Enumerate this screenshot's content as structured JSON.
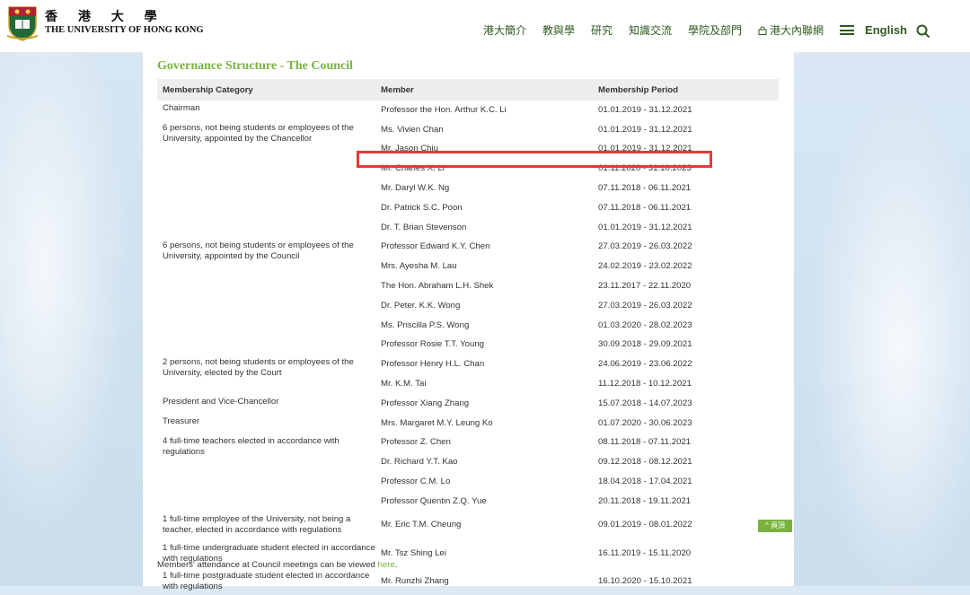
{
  "header": {
    "logo_cn": "香 港 大 學",
    "logo_en": "THE UNIVERSITY OF HONG KONG",
    "nav": [
      "港大簡介",
      "教與學",
      "研究",
      "知識交流",
      "學院及部門"
    ],
    "intranet": "港大內聯網",
    "language": "English"
  },
  "page": {
    "title": "Governance Structure - The Council",
    "columns": [
      "Membership Category",
      "Member",
      "Membership Period"
    ],
    "footnote_text": "Members' attendance at Council meetings can be viewed ",
    "footnote_link": "here",
    "footnote_end": ".",
    "top_button": "^ 頁頂"
  },
  "rows": [
    {
      "category": "Chairman",
      "member": "Professor the Hon. Arthur K.C. Li",
      "period": "01.01.2019 - 31.12.2021"
    },
    {
      "category": "6 persons, not being students or employees of the University, appointed by the Chancellor",
      "member": "Ms. Vivien Chan",
      "period": "01.01.2019 - 31.12.2021"
    },
    {
      "category": "",
      "member": "Mr. Jason Chiu",
      "period": "01.01.2019 - 31.12.2021"
    },
    {
      "category": "",
      "member": "Mr. Charles X. Li",
      "period": "01.11.2020 - 31.10.2023"
    },
    {
      "category": "",
      "member": "Mr. Daryl W.K. Ng",
      "period": "07.11.2018 - 06.11.2021"
    },
    {
      "category": "",
      "member": "Dr. Patrick S.C. Poon",
      "period": "07.11.2018 - 06.11.2021"
    },
    {
      "category": "",
      "member": "Dr. T. Brian Stevenson",
      "period": "01.01.2019 - 31.12.2021"
    },
    {
      "category": "6 persons, not being students or employees of the University, appointed by the Council",
      "member": "Professor Edward K.Y. Chen",
      "period": "27.03.2019 - 26.03.2022"
    },
    {
      "category": "",
      "member": "Mrs. Ayesha M. Lau",
      "period": "24.02.2019 - 23.02.2022"
    },
    {
      "category": "",
      "member": "The Hon. Abraham L.H. Shek",
      "period": "23.11.2017 - 22.11.2020"
    },
    {
      "category": "",
      "member": "Dr. Peter. K.K. Wong",
      "period": "27.03.2019 - 26.03.2022"
    },
    {
      "category": "",
      "member": "Ms. Priscilla P.S. Wong",
      "period": "01.03.2020 - 28.02.2023"
    },
    {
      "category": "",
      "member": "Professor Rosie T.T. Young",
      "period": "30.09.2018 - 29.09.2021"
    },
    {
      "category": "2 persons, not being students or employees of the University, elected by the Court",
      "member": "Professor Henry H.L. Chan",
      "period": "24.06.2019 - 23.06.2022"
    },
    {
      "category": "",
      "member": "Mr. K.M. Tai",
      "period": "11.12.2018 - 10.12.2021"
    },
    {
      "category": "President and Vice-Chancellor",
      "member": "Professor Xiang Zhang",
      "period": "15.07.2018 - 14.07.2023"
    },
    {
      "category": "Treasurer",
      "member": "Mrs. Margaret M.Y. Leung Ko",
      "period": "01.07.2020 - 30.06.2023"
    },
    {
      "category": "4 full-time teachers elected in accordance with regulations",
      "member": "Professor Z. Chen",
      "period": "08.11.2018 - 07.11.2021"
    },
    {
      "category": "",
      "member": "Dr. Richard Y.T. Kao",
      "period": "09.12.2018 - 08.12.2021"
    },
    {
      "category": "",
      "member": "Professor C.M. Lo",
      "period": "18.04.2018 - 17.04.2021"
    },
    {
      "category": "",
      "member": "Professor Quentin Z.Q. Yue",
      "period": "20.11.2018 - 19.11.2021"
    },
    {
      "category": "1 full-time employee of the University, not being a teacher, elected in accordance with regulations",
      "member": "Mr. Eric T.M. Cheung",
      "period": "09.01.2019 - 08.01.2022"
    },
    {
      "category": "1 full-time undergraduate student elected in accordance with regulations",
      "member": "Mr. Tsz Shing Lei",
      "period": "16.11.2019 - 15.11.2020"
    },
    {
      "category": "1 full-time postgraduate student elected in accordance with regulations",
      "member": "Mr. Runzhi Zhang",
      "period": "16.10.2020 - 15.10.2021"
    }
  ],
  "colors": {
    "accent": "#79b33e",
    "nav": "#2d5a1e",
    "highlight": "#e53935"
  }
}
